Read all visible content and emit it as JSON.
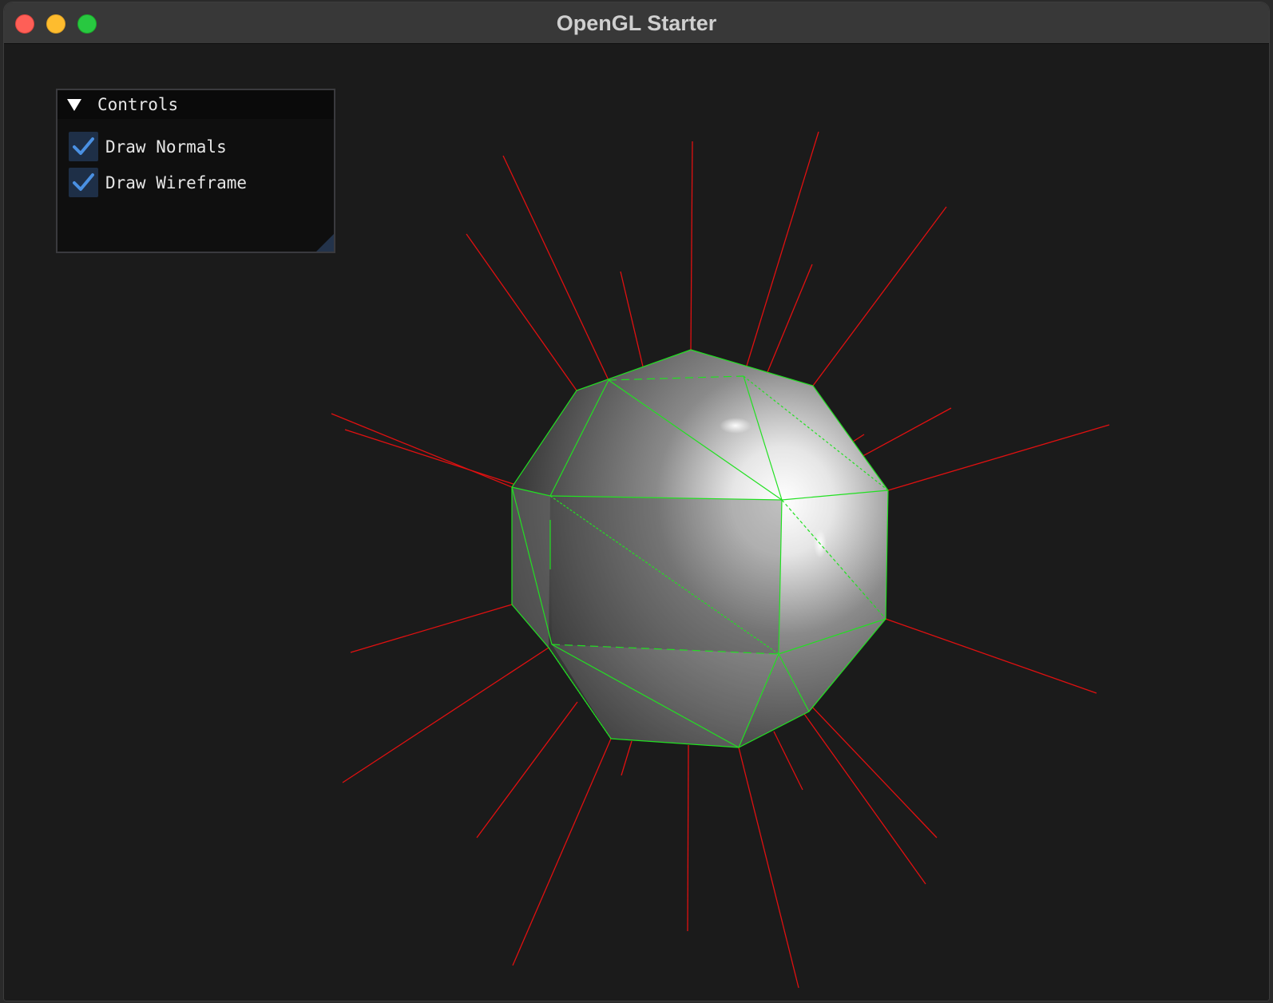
{
  "window": {
    "title": "OpenGL Starter"
  },
  "controls_panel": {
    "title": "Controls",
    "collapsed": false,
    "checkboxes": [
      {
        "label": "Draw Normals",
        "checked": true
      },
      {
        "label": "Draw Wireframe",
        "checked": true
      }
    ]
  },
  "scene": {
    "object": "icosphere",
    "normals_color": "#e01010",
    "wireframe_color": "#22e022",
    "background_color": "#1b1b1b"
  },
  "icons": {
    "close": "close-icon",
    "minimize": "minimize-icon",
    "maximize": "maximize-icon",
    "collapse": "triangle-down-icon",
    "checkmark": "checkmark-icon"
  },
  "colors": {
    "accent": "#4a90e2",
    "checkbox_bg": "#1e2f47"
  }
}
